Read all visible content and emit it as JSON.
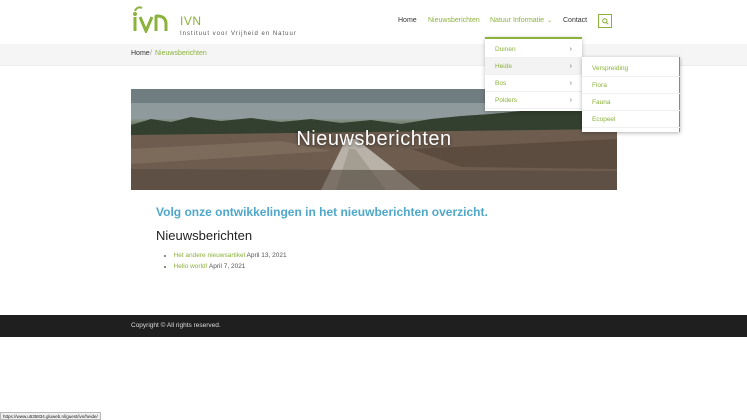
{
  "header": {
    "site_title": "IVN",
    "tagline": "Instituut voor Vrijheid en Natuur",
    "nav": {
      "home": "Home",
      "news": "Nieuwsberichten",
      "info": "Natuur Informatie",
      "contact": "Contact"
    },
    "search_icon": "search-icon"
  },
  "breadcrumb": {
    "home": "Home",
    "separator": "/",
    "current": "Nieuwsberichten"
  },
  "dropdown": {
    "items": [
      {
        "label": "Duinen"
      },
      {
        "label": "Heide"
      },
      {
        "label": "Bos"
      },
      {
        "label": "Polders"
      }
    ],
    "submenu": [
      {
        "label": "Verspreiding"
      },
      {
        "label": "Flora"
      },
      {
        "label": "Fauna"
      },
      {
        "label": "Ecopeel"
      }
    ]
  },
  "hero": {
    "title": "Nieuwsberichten"
  },
  "main": {
    "intro": "Volg onze ontwikkelingen in het nieuwberichten overzicht.",
    "heading": "Nieuwsberichten",
    "posts": [
      {
        "title": "Het andere nieuwsartikel",
        "date": "April 13, 2021"
      },
      {
        "title": "Hello world!",
        "date": "April 7, 2021"
      }
    ]
  },
  "footer": {
    "copyright": "Copyright © All rights reserved."
  },
  "status_bar": {
    "url": "https://www.u535834.gluweb.nl/guest/ivn/heide/"
  },
  "colors": {
    "brand_green": "#8bb23c",
    "intro_blue": "#4fa8c9",
    "footer_bg": "#1f1f1f"
  }
}
